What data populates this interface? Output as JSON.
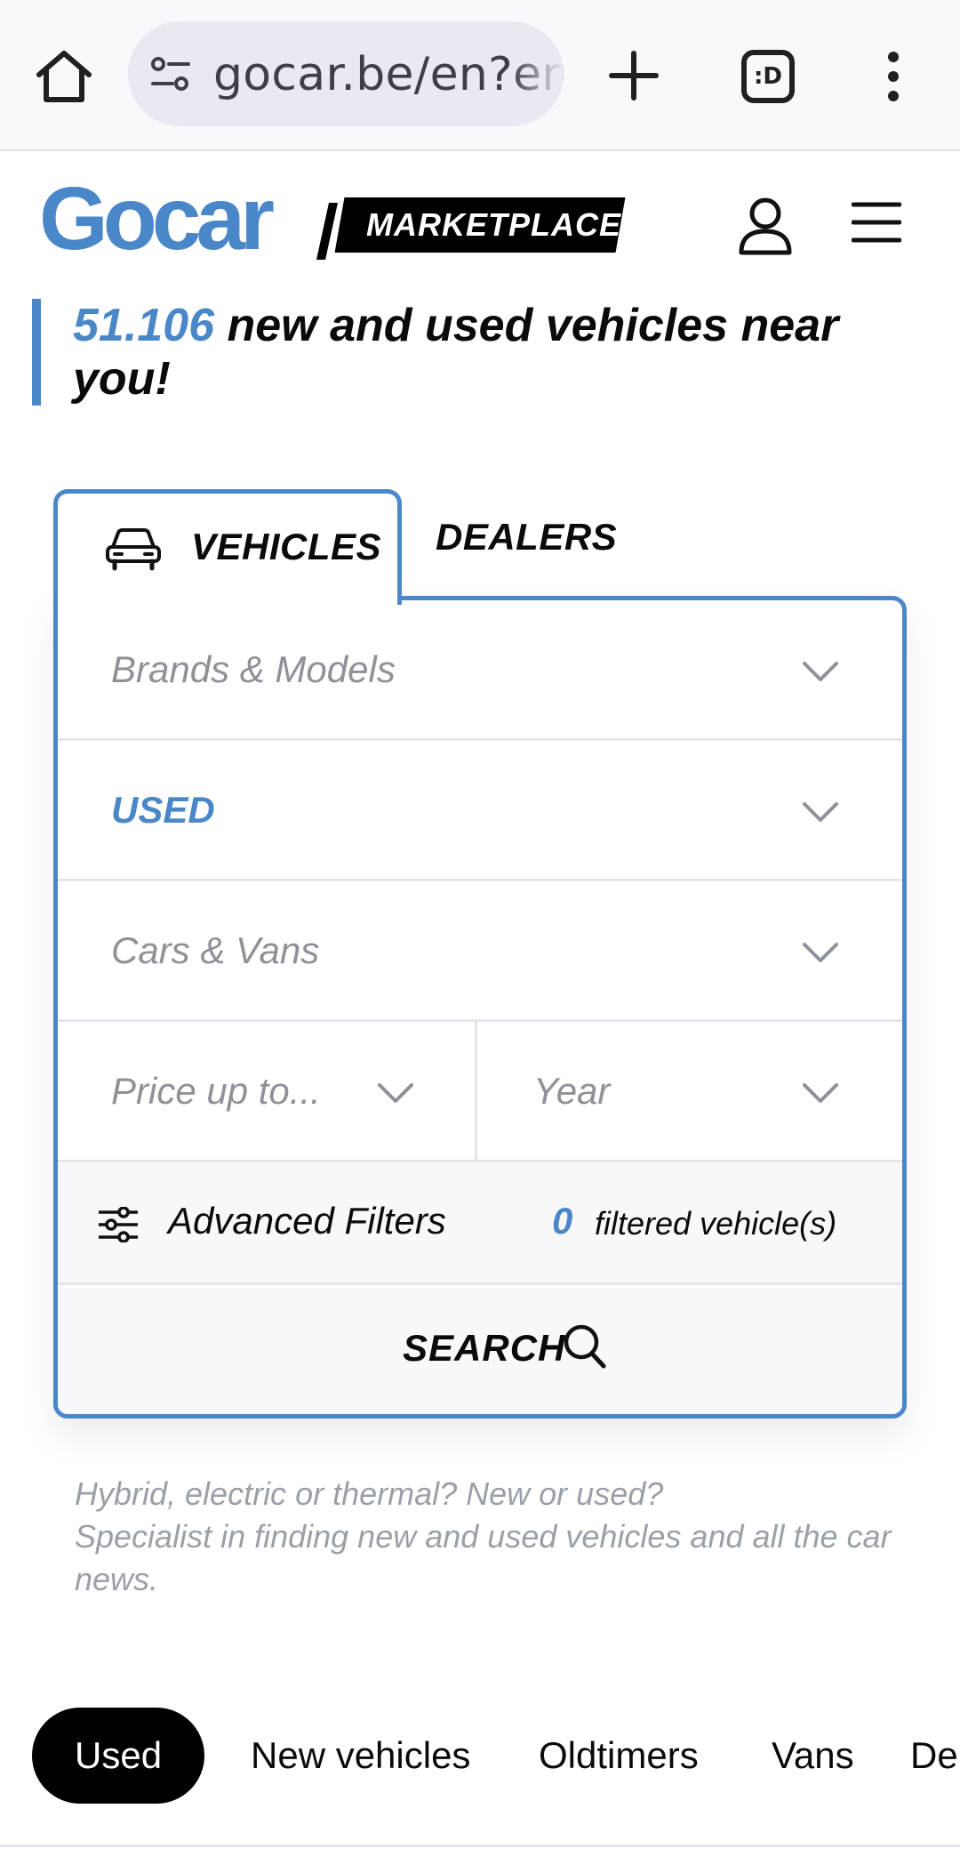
{
  "browser": {
    "url": "gocar.be/en?en",
    "tabs_count": ":D",
    "icons": {
      "home": "home-icon",
      "site_settings": "tune-icon",
      "new_tab": "plus-icon",
      "menu": "more-vert-icon"
    }
  },
  "header": {
    "logo": "Gocar",
    "badge": "MARKETPLACE",
    "icons": {
      "account": "user-icon",
      "menu": "hamburger-icon"
    }
  },
  "headline": {
    "count": "51.106",
    "text": " new and used vehicles near you!"
  },
  "search": {
    "tabs": [
      {
        "label": "VEHICLES",
        "icon": "car-icon",
        "active": true
      },
      {
        "label": "DEALERS",
        "active": false
      }
    ],
    "brands_placeholder": "Brands & Models",
    "condition_value": "USED",
    "type_placeholder": "Cars & Vans",
    "price_placeholder": "Price up to...",
    "year_placeholder": "Year",
    "advanced_label": "Advanced Filters",
    "filtered_count": "0",
    "filtered_label": "filtered vehicle(s)",
    "search_label": "SEARCH"
  },
  "description": {
    "line1": "Hybrid, electric or thermal? New or used?",
    "line2": "Specialist in finding new and used vehicles and all the car news."
  },
  "categories": [
    "Used",
    "New vehicles",
    "Oldtimers",
    "Vans",
    "De"
  ],
  "colors": {
    "accent": "#4a87c9",
    "text": "#0a0a0a",
    "muted": "#8e9198"
  }
}
